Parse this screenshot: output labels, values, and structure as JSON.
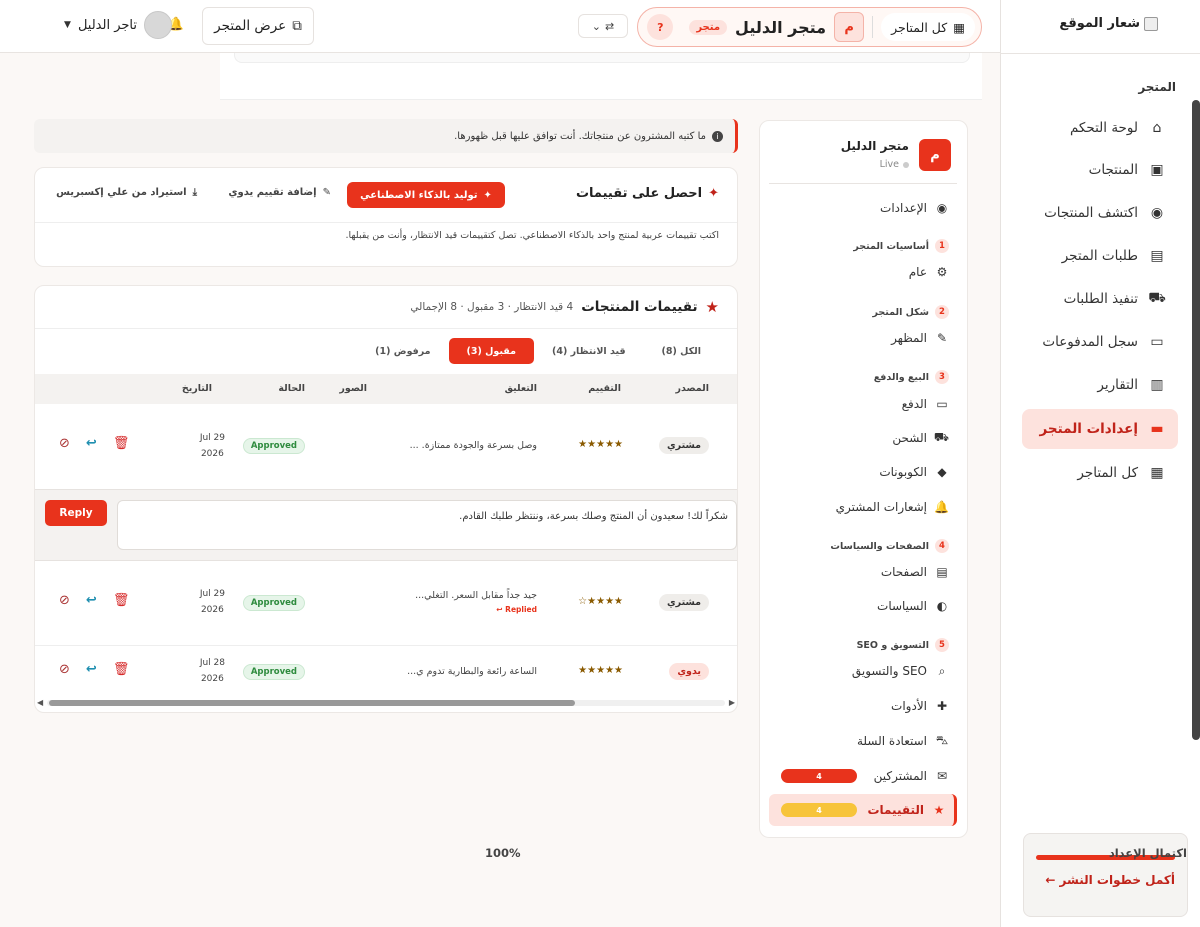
{
  "main_sidebar": {
    "logo_text": "شعار الموقع",
    "section_title": "المتجر",
    "items": [
      {
        "label": "لوحة التحكم",
        "icon": "home-icon",
        "glyph": "⌂"
      },
      {
        "label": "المنتجات",
        "icon": "box-icon",
        "glyph": "▣"
      },
      {
        "label": "اكتشف المنتجات",
        "icon": "compass-icon",
        "glyph": "◉"
      },
      {
        "label": "طلبات المتجر",
        "icon": "receipt-icon",
        "glyph": "▤"
      },
      {
        "label": "تنفيذ الطلبات",
        "icon": "truck-icon",
        "glyph": "⛟"
      },
      {
        "label": "سجل المدفوعات",
        "icon": "money-icon",
        "glyph": "▭"
      },
      {
        "label": "التقارير",
        "icon": "chart-icon",
        "glyph": "▥"
      },
      {
        "label": "إعدادات المتجر",
        "icon": "store-icon",
        "glyph": "▬",
        "active": true
      },
      {
        "label": "كل المتاجر",
        "icon": "grid-icon",
        "glyph": "▦"
      }
    ],
    "completion": {
      "title": "اكتمال الإعداد",
      "percent": "100%",
      "fill": 1.0,
      "link": "أكمل خطوات النشر ←"
    }
  },
  "topbar": {
    "all_stores": "كل المتاجر",
    "store_initial": "م",
    "store_name": "متجر الدليل",
    "store_badge": "متجر",
    "help": "?",
    "view_store": "عرض المتجر",
    "user_name": "تاجر الدليل"
  },
  "settings_panel": {
    "store_initial": "م",
    "store_name": "متجر الدليل",
    "status": "Live",
    "settings_label": "الإعدادات",
    "groups": [
      {
        "num": "1",
        "title": "أساسيات المتجر"
      },
      {
        "num": "2",
        "title": "شكل المتجر"
      },
      {
        "num": "3",
        "title": "البيع والدفع"
      },
      {
        "num": "4",
        "title": "الصفحات والسياسات"
      },
      {
        "num": "5",
        "title": "التسويق و SEO"
      }
    ],
    "items": {
      "general": "عام",
      "appearance": "المظهر",
      "payment": "الدفع",
      "shipping": "الشحن",
      "coupons": "الكوبونات",
      "notifications": "إشعارات المشتري",
      "pages": "الصفحات",
      "policies": "السياسات",
      "seo": "SEO والتسويق",
      "tools": "الأدوات",
      "cart_recovery": "استعادة السلة",
      "subscribers": "المشتركين",
      "reviews": "التقييمات"
    },
    "subscribers_count": "4",
    "reviews_count": "4"
  },
  "info_banner": "ما كتبه المشترون عن منتجاتك. أنت توافق عليها قبل ظهورها.",
  "get_reviews": {
    "title": "احصل على تقييمات",
    "ai_button": "توليد بالذكاء الاصطناعي",
    "manual_button": "إضافة تقييم يدوي",
    "import_button": "استيراد من علي إكسبريس",
    "description": "اكتب تقييمات عربية لمنتج واحد بالذكاء الاصطناعي. تصل كتقييمات قيد الانتظار، وأنت من يقبلها."
  },
  "reviews": {
    "title": "تقييمات المنتجات",
    "summary": "4 قيد الانتظار · 3 مقبول · 8 الإجمالي",
    "tabs": [
      "الكل (8)",
      "قيد الانتظار (4)",
      "مقبول (3)",
      "مرفوض (1)"
    ],
    "active_tab": 2,
    "columns": {
      "source": "المصدر",
      "rating": "التقييم",
      "comment": "التعليق",
      "images": "الصور",
      "status": "الحالة",
      "date": "التاريخ"
    },
    "rows": [
      {
        "source": "مشتري",
        "stars": "★★★★★",
        "rating": 5,
        "comment": "وصل بسرعة والجودة ممتازة. ...",
        "replied": "",
        "status": "Approved",
        "date_day": "29 Jul",
        "date_year": "2026"
      },
      {
        "source": "مشتري",
        "stars": "★★★★☆",
        "rating": 4,
        "comment": "جيد جداً مقابل السعر. التغلي...",
        "replied": "Replied ↩",
        "status": "Approved",
        "date_day": "29 Jul",
        "date_year": "2026"
      },
      {
        "source": "يدوي",
        "stars": "★★★★★",
        "rating": 5,
        "comment": "الساعة رائعة والبطارية تدوم ي...",
        "replied": "",
        "status": "Approved",
        "date_day": "28 Jul",
        "date_year": "2026"
      }
    ],
    "reply_text": "شكراً لك! سعيدون أن المنتج وصلك بسرعة، وننتظر طلبك القادم.",
    "reply_button": "Reply"
  },
  "colors": {
    "accent": "#e8331c",
    "accent_light": "#fde2dd",
    "approved": "#2e8b3e",
    "yellow_pill": "#f7c43a"
  }
}
